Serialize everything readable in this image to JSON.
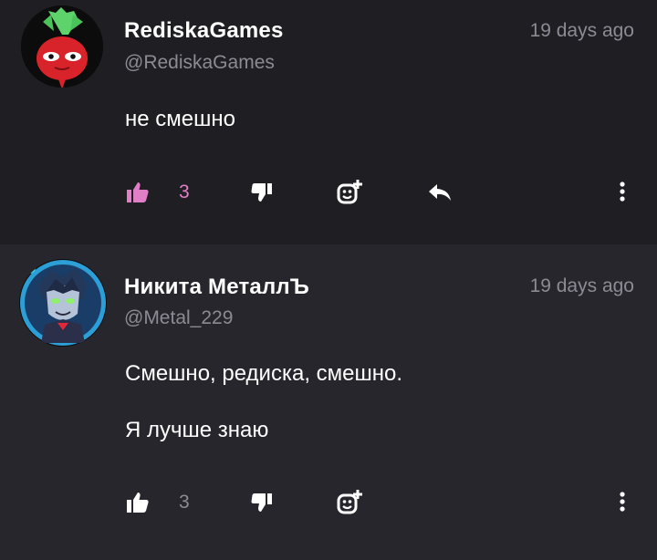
{
  "comments": [
    {
      "author": "RediskaGames",
      "handle": "@RediskaGames",
      "time": "19 days ago",
      "lines": [
        "не смешно"
      ],
      "likes": "3",
      "liked": true
    },
    {
      "author": "Никита МеталлЪ",
      "handle": "@Metal_229",
      "time": "19 days ago",
      "lines": [
        "Смешно, редиска, смешно.",
        "Я лучше знаю"
      ],
      "likes": "3",
      "liked": false
    }
  ],
  "colors": {
    "liked_accent": "#e07fc7",
    "muted": "#8c8b94",
    "bg_first": "#1f1e23",
    "bg_second": "#27262c"
  },
  "icons": {
    "like": "thumbs-up-icon",
    "dislike": "thumbs-down-icon",
    "emoji": "add-reaction-icon",
    "reply": "reply-arrow-icon",
    "more": "vertical-dots-icon"
  }
}
